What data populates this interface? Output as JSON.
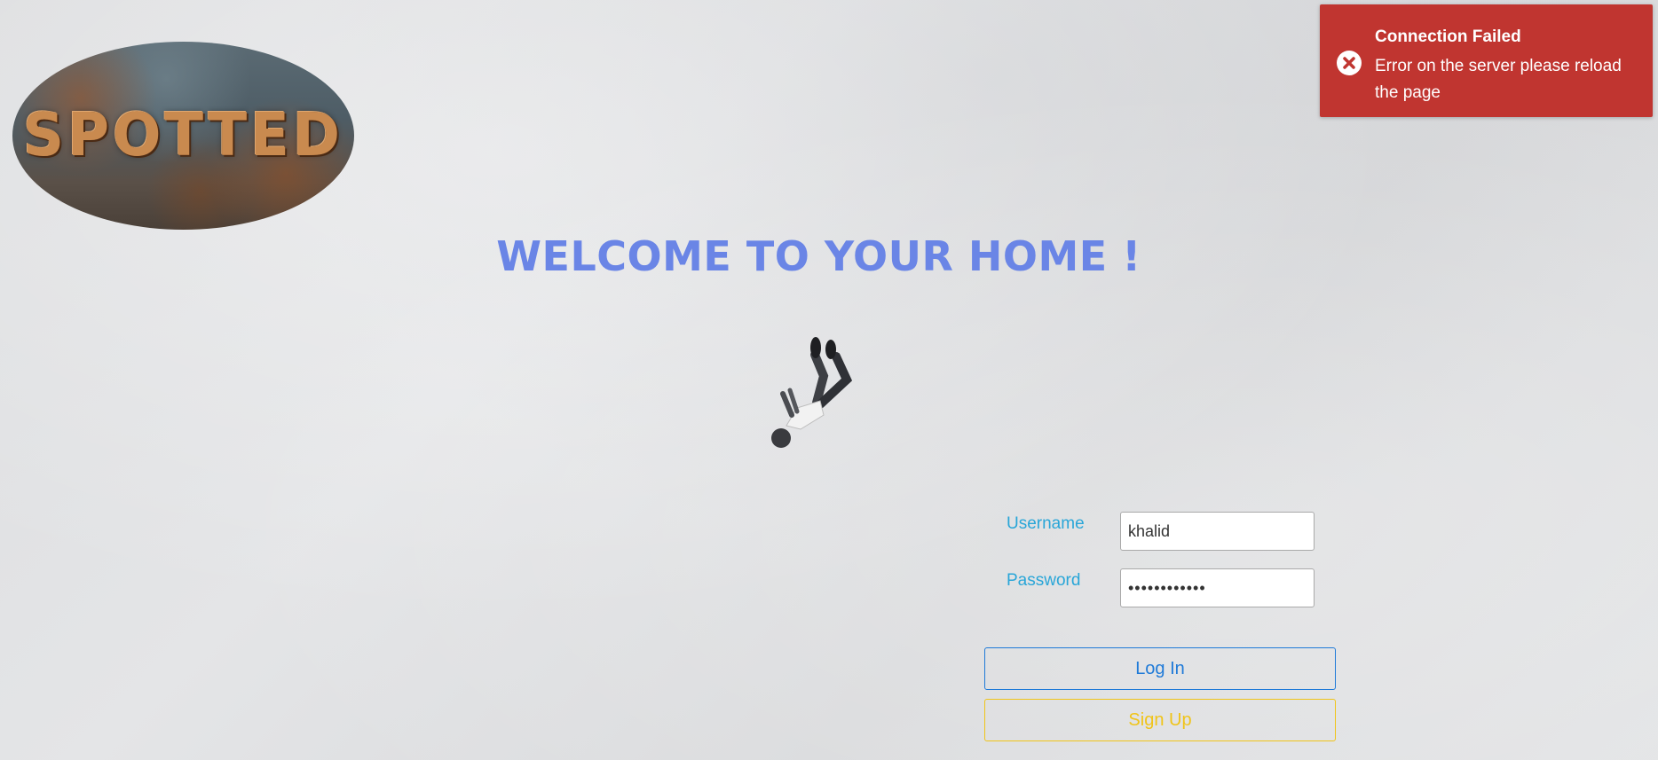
{
  "logo": {
    "text": "SPOTTED"
  },
  "title": "WELCOME TO YOUR HOME !",
  "form": {
    "username_label": "Username",
    "username_value": "khalid",
    "password_label": "Password",
    "password_value": "••••••••••••",
    "login_label": "Log In",
    "signup_label": "Sign Up"
  },
  "toast": {
    "title": "Connection Failed",
    "message": "Error on the server please reload the page",
    "icon": "error-circle-icon"
  },
  "colors": {
    "title": "#6a85e6",
    "label": "#29a6d8",
    "login": "#1f7ad8",
    "signup": "#f0c419",
    "toast_bg": "#c03530"
  }
}
